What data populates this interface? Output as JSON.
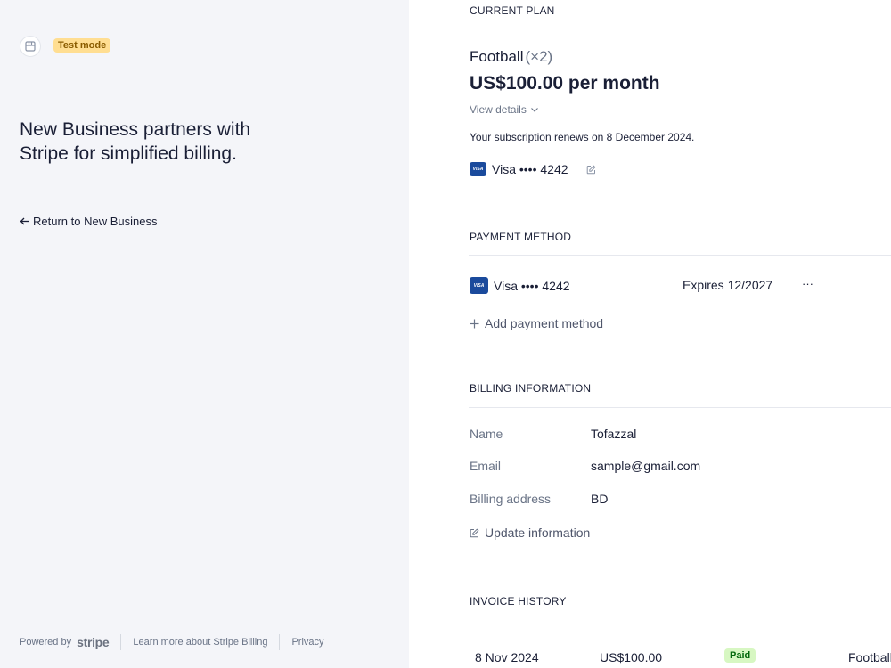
{
  "left": {
    "badge": "Test mode",
    "headline": "New Business partners with Stripe for simplified billing.",
    "return_link": "Return to New Business",
    "footer": {
      "powered_by": "Powered by",
      "stripe_word": "stripe",
      "learn_more": "Learn more about Stripe Billing",
      "privacy": "Privacy"
    }
  },
  "current_plan": {
    "title": "CURRENT PLAN",
    "plan_name": "Football",
    "plan_qty": "(×2)",
    "price": "US$100.00 per month",
    "view_details": "View details",
    "renewal": "Your subscription renews on 8 December 2024.",
    "card_brand": "VISA",
    "card": "Visa •••• 4242"
  },
  "payment_method": {
    "title": "PAYMENT METHOD",
    "card_brand": "VISA",
    "card": "Visa •••• 4242",
    "expires": "Expires 12/2027",
    "more": "···",
    "add_label": "Add payment method"
  },
  "billing_info": {
    "title": "BILLING INFORMATION",
    "rows": [
      {
        "label": "Name",
        "value": "Tofazzal"
      },
      {
        "label": "Email",
        "value": "sample@gmail.com"
      },
      {
        "label": "Billing address",
        "value": "BD"
      }
    ],
    "update_label": "Update information"
  },
  "invoice_history": {
    "title": "INVOICE HISTORY",
    "rows": [
      {
        "date": "8 Nov 2024",
        "amount": "US$100.00",
        "status": "Paid",
        "product": "Football"
      }
    ]
  },
  "colors": {
    "left_bg": "#f4f5f9",
    "test_badge_bg": "#ffde92",
    "paid_badge_bg": "#d7f7c2",
    "visa_blue": "#1a4a9c"
  },
  "icons": {
    "logo": "storefront-icon",
    "return": "arrow-left-icon",
    "view_details": "chevron-down-icon",
    "edit": "edit-icon",
    "add": "plus-icon",
    "more": "more-horizontal-icon"
  }
}
